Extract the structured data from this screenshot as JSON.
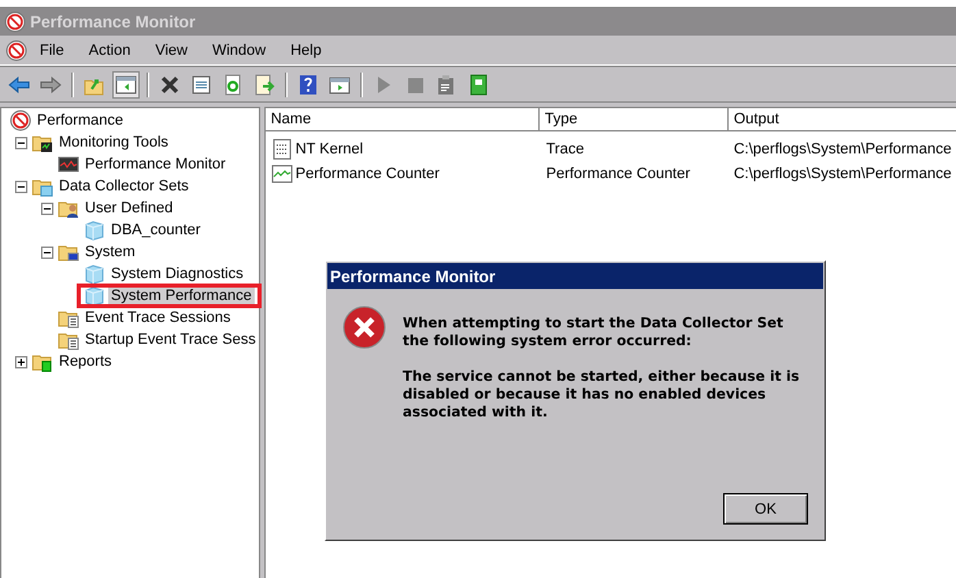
{
  "window": {
    "title": "Performance Monitor"
  },
  "menu": [
    "File",
    "Action",
    "View",
    "Window",
    "Help"
  ],
  "tree": [
    {
      "label": "Performance",
      "kind": "root",
      "selected": false,
      "children": [
        {
          "label": "Monitoring Tools",
          "kind": "tools-folder",
          "expanded": true,
          "selected": false,
          "children": [
            {
              "label": "Performance Monitor",
              "kind": "monitor",
              "selected": false
            }
          ]
        },
        {
          "label": "Data Collector Sets",
          "kind": "sets-folder",
          "expanded": true,
          "selected": false,
          "children": [
            {
              "label": "User Defined",
              "kind": "user-folder",
              "expanded": true,
              "selected": false,
              "children": [
                {
                  "label": "DBA_counter",
                  "kind": "set",
                  "selected": false
                }
              ]
            },
            {
              "label": "System",
              "kind": "system-folder",
              "expanded": true,
              "selected": false,
              "children": [
                {
                  "label": "System Diagnostics",
                  "kind": "set",
                  "selected": false
                },
                {
                  "label": "System Performance",
                  "kind": "set",
                  "selected": true,
                  "marked": true
                }
              ]
            },
            {
              "label": "Event Trace Sessions",
              "kind": "trace-folder",
              "selected": false
            },
            {
              "label": "Startup Event Trace Sess",
              "kind": "trace-folder",
              "selected": false
            }
          ]
        },
        {
          "label": "Reports",
          "kind": "reports-folder",
          "expanded": false,
          "selected": false
        }
      ]
    }
  ],
  "list": {
    "columns": [
      "Name",
      "Type",
      "Output"
    ],
    "rows": [
      {
        "name": "NT Kernel",
        "kind": "trace",
        "type": "Trace",
        "output": "C:\\perflogs\\System\\Performance"
      },
      {
        "name": "Performance Counter",
        "kind": "counter",
        "type": "Performance Counter",
        "output": "C:\\perflogs\\System\\Performance"
      }
    ]
  },
  "dialog": {
    "title": "Performance Monitor",
    "paragraphs": [
      "When attempting to start the Data Collector Set the following system error occurred:",
      "The service cannot be started, either because it is disabled or because it has no enabled devices associated with it."
    ],
    "button": "OK"
  }
}
